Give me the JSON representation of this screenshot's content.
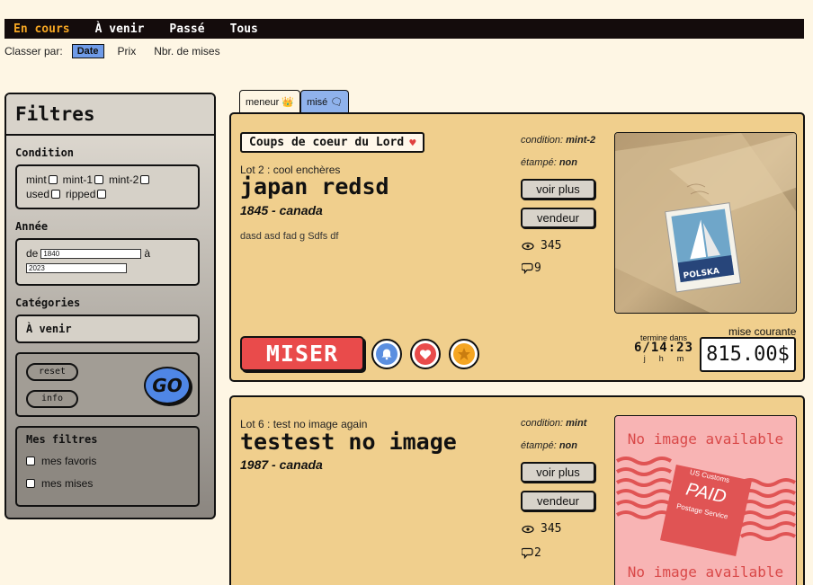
{
  "nav": {
    "tabs": [
      "En cours",
      "À venir",
      "Passé",
      "Tous"
    ]
  },
  "sort": {
    "label": "Classer par:",
    "options": [
      "Date",
      "Prix",
      "Nbr. de mises"
    ]
  },
  "sidebar": {
    "title": "Filtres",
    "condition": {
      "title": "Condition",
      "options": [
        "mint",
        "mint-1",
        "mint-2",
        "used",
        "ripped"
      ]
    },
    "annee": {
      "title": "Année",
      "from_label": "de",
      "from_value": "1840",
      "to_label": "à",
      "to_value": "2023"
    },
    "categories": {
      "title": "Catégories",
      "selected": "À venir"
    },
    "reset_label": "reset",
    "info_label": "info",
    "go_label": "GO",
    "mes_filtres": {
      "title": "Mes filtres",
      "favoris": "mes favoris",
      "mises": "mes mises"
    }
  },
  "bid_tabs": {
    "meneur": "meneur 👑",
    "mise": "misé 🗨"
  },
  "lots": [
    {
      "badge": "Coups de coeur du Lord",
      "lot_line": "Lot 2 : cool enchères",
      "title": "japan redsd",
      "subtitle": "1845 - canada",
      "description": "dasd asd fad g Sdfs df",
      "condition_label": "condition:",
      "condition": "mint-2",
      "etampe_label": "étampé:",
      "etampe": "non",
      "voir_plus": "voir plus",
      "vendeur": "vendeur",
      "views": "345",
      "bids": "9",
      "image": "stamp-photo",
      "miser": "MISER",
      "ends_label": "termine dans",
      "days": "6",
      "separator": "/",
      "time": "14:23",
      "units": [
        "j",
        "h",
        "m"
      ],
      "current_label": "mise courante",
      "price": "815.00$"
    },
    {
      "lot_line": "Lot 6 : test no image again",
      "title": "testest no image",
      "subtitle": "1987 - canada",
      "condition_label": "condition:",
      "condition": "mint",
      "etampe_label": "étampé:",
      "etampe": "non",
      "voir_plus": "voir plus",
      "vendeur": "vendeur",
      "views": "345",
      "bids": "2",
      "no_image_text": "No image available",
      "stamp_top": "US Customs",
      "stamp_mid": "PAID",
      "stamp_bot": "Postage Service"
    }
  ],
  "colors": {
    "nav_active": "#f5a623",
    "card_bg": "#f0cf8d",
    "miser": "#e94b4b",
    "go": "#4f86e5",
    "noimage_bg": "#f8b4b4"
  }
}
